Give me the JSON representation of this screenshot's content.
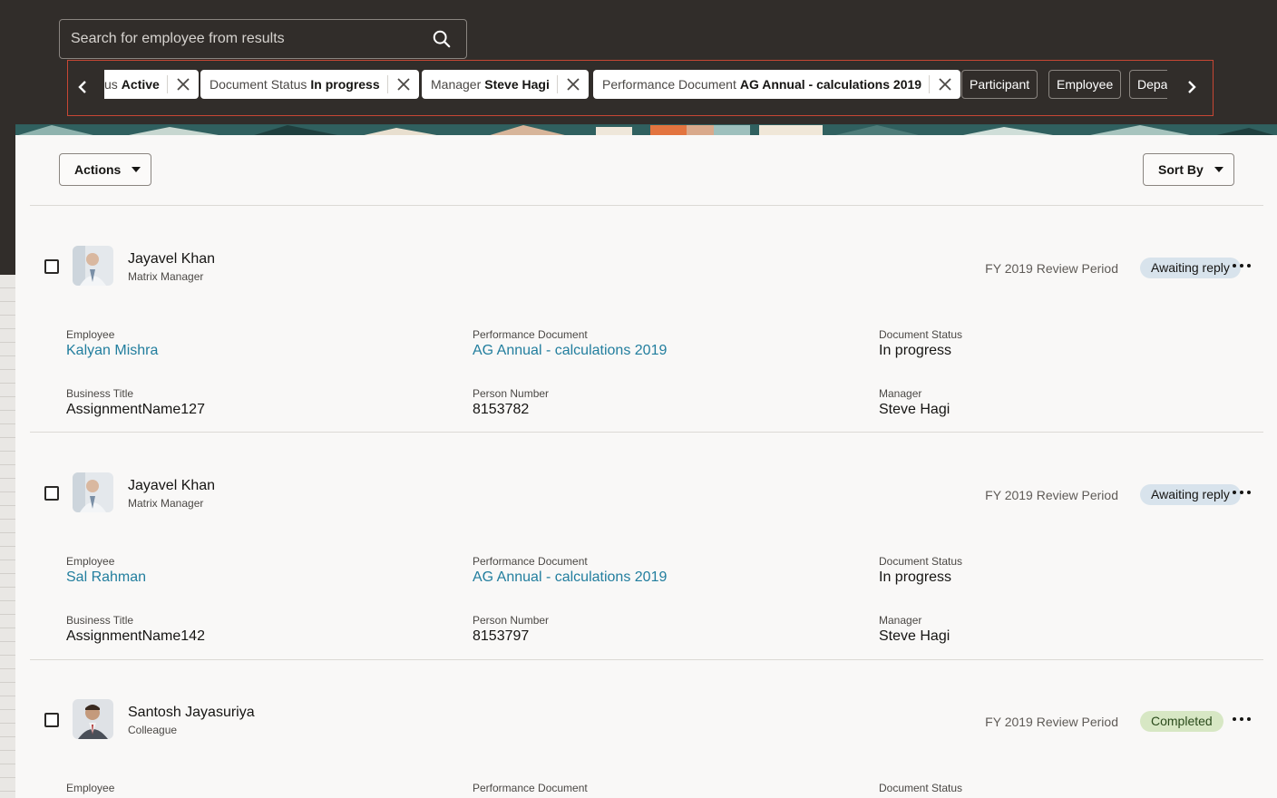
{
  "search": {
    "placeholder": "Search for employee from results"
  },
  "filters": {
    "applied": [
      {
        "label": "Assignment Status",
        "value": "Active",
        "visible_label": "us"
      },
      {
        "label": "Document Status",
        "value": "In progress"
      },
      {
        "label": "Manager",
        "value": "Steve Hagi"
      },
      {
        "label": "Performance Document",
        "value": "AG Annual - calculations 2019"
      }
    ],
    "facets": [
      "Participant",
      "Employee",
      "Depa"
    ]
  },
  "toolbar": {
    "actions_label": "Actions",
    "sort_label": "Sort By"
  },
  "labels": {
    "employee": "Employee",
    "performance_document": "Performance Document",
    "document_status": "Document Status",
    "business_title": "Business Title",
    "person_number": "Person Number",
    "manager": "Manager"
  },
  "cards": [
    {
      "participant": "Jayavel Khan",
      "role": "Matrix Manager",
      "period": "FY 2019 Review Period",
      "status": "Awaiting reply",
      "employee": "Kalyan Mishra",
      "document": "AG Annual - calculations 2019",
      "doc_status": "In progress",
      "business_title": "AssignmentName127",
      "person_number": "8153782",
      "manager": "Steve Hagi"
    },
    {
      "participant": "Jayavel Khan",
      "role": "Matrix Manager",
      "period": "FY 2019 Review Period",
      "status": "Awaiting reply",
      "employee": "Sal Rahman",
      "document": "AG Annual - calculations 2019",
      "doc_status": "In progress",
      "business_title": "AssignmentName142",
      "person_number": "8153797",
      "manager": "Steve Hagi"
    },
    {
      "participant": "Santosh Jayasuriya",
      "role": "Colleague",
      "period": "FY 2019 Review Period",
      "status": "Completed"
    }
  ],
  "colors": {
    "header_bg": "#312d2a",
    "link": "#227e9e",
    "awaiting_badge": "#d8e3ec",
    "completed_badge": "#d7e7c4",
    "highlight_border": "#c74634"
  }
}
